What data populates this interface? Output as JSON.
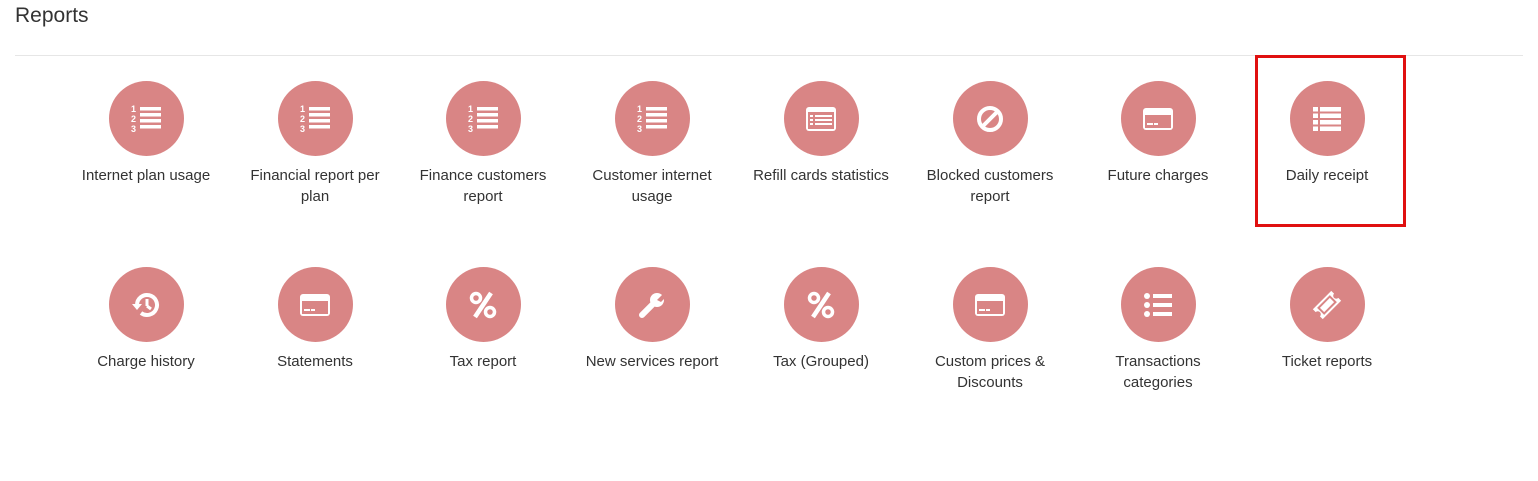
{
  "page": {
    "title": "Reports"
  },
  "colors": {
    "icon_circle": "#d98585",
    "highlight_border": "#e01010"
  },
  "reports": [
    {
      "label": "Internet plan usage",
      "icon": "ordered-list-icon"
    },
    {
      "label": "Financial report per plan",
      "icon": "ordered-list-icon"
    },
    {
      "label": "Finance customers report",
      "icon": "ordered-list-icon"
    },
    {
      "label": "Customer internet usage",
      "icon": "ordered-list-icon"
    },
    {
      "label": "Refill cards statistics",
      "icon": "list-card-icon"
    },
    {
      "label": "Blocked customers report",
      "icon": "ban-icon"
    },
    {
      "label": "Future charges",
      "icon": "credit-card-icon"
    },
    {
      "label": "Daily receipt",
      "icon": "list-icon",
      "highlighted": true
    },
    {
      "label": "Charge history",
      "icon": "history-icon"
    },
    {
      "label": "Statements",
      "icon": "credit-card-icon"
    },
    {
      "label": "Tax report",
      "icon": "percent-icon"
    },
    {
      "label": "New services report",
      "icon": "wrench-icon"
    },
    {
      "label": "Tax (Grouped)",
      "icon": "percent-icon"
    },
    {
      "label": "Custom prices & Discounts",
      "icon": "credit-card-icon"
    },
    {
      "label": "Transactions categories",
      "icon": "bulleted-list-icon"
    },
    {
      "label": "Ticket reports",
      "icon": "ticket-icon"
    }
  ]
}
